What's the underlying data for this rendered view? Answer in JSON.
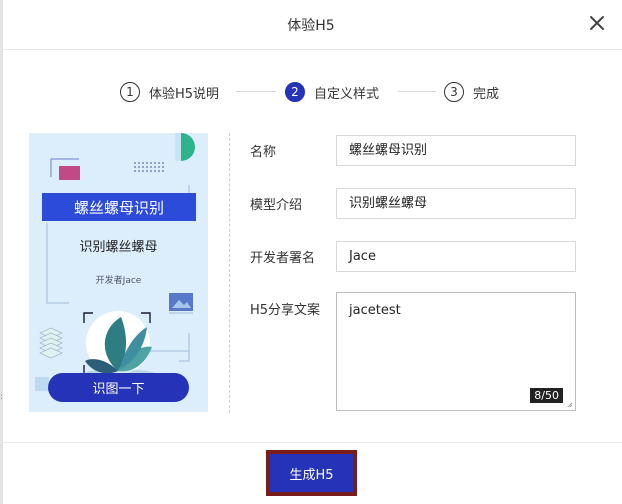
{
  "dialog": {
    "title": "体验H5"
  },
  "steps": [
    {
      "number": "1",
      "label": "体验H5说明",
      "active": false
    },
    {
      "number": "2",
      "label": "自定义样式",
      "active": true
    },
    {
      "number": "3",
      "label": "完成",
      "active": false
    }
  ],
  "preview": {
    "title": "螺丝螺母识别",
    "subtitle": "识别螺丝螺母",
    "developer": "开发者Jace",
    "button": "识图一下"
  },
  "form": {
    "name": {
      "label": "名称",
      "value": "螺丝螺母识别"
    },
    "intro": {
      "label": "模型介绍",
      "value": "识别螺丝螺母"
    },
    "developer": {
      "label": "开发者署名",
      "value": "Jace"
    },
    "share": {
      "label": "H5分享文案",
      "value": "jacetest",
      "counter": "8/50"
    }
  },
  "footer": {
    "generate_label": "生成H5"
  },
  "colors": {
    "primary": "#2433b8",
    "highlight_frame": "#7a1c1c",
    "preview_bg": "#dcedfb"
  }
}
